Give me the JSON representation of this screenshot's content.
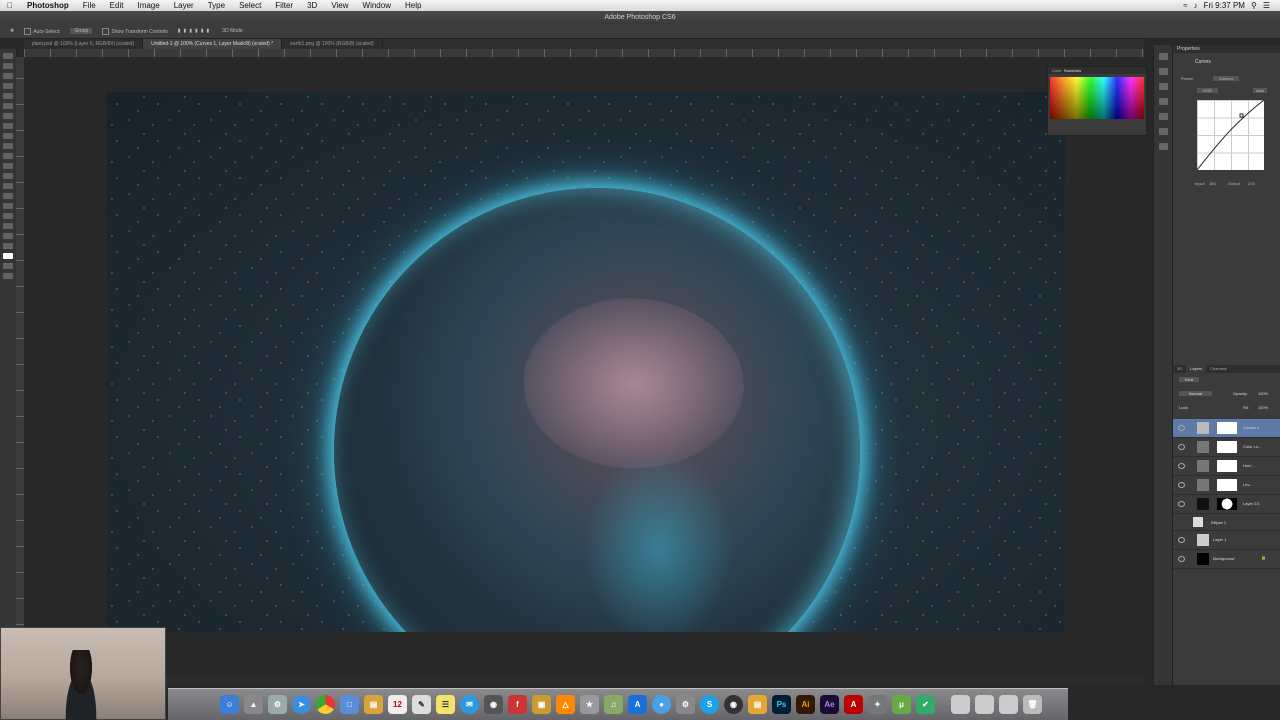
{
  "menubar": {
    "apple": "",
    "app_name": "Photoshop",
    "items": [
      "File",
      "Edit",
      "Image",
      "Layer",
      "Type",
      "Select",
      "Filter",
      "3D",
      "View",
      "Window",
      "Help"
    ],
    "clock": "Fri 9:37 PM"
  },
  "window": {
    "title": "Adobe Photoshop CS6"
  },
  "options_bar": {
    "auto_select_label": "Auto-Select:",
    "auto_select_value": "Group",
    "transform_label": "Show Transform Controls",
    "mode_3d": "3D Mode:"
  },
  "doc_tabs": [
    {
      "label": "plant.psd @ 100% (Layer 6, RGB/8#) (scaled)"
    },
    {
      "label": "Untitled-1 @ 100% (Curves 1, Layer Mask/8) (scaled) *"
    },
    {
      "label": "earth1.png @ 100% (RGB/8) (scaled)"
    }
  ],
  "swatches_panel": {
    "tab_color": "Color",
    "tab_swatches": "Swatches"
  },
  "properties_panel": {
    "title": "Properties",
    "adjustment": "Curves",
    "preset_label": "Preset:",
    "preset_value": "Custom",
    "channel_value": "RGB",
    "auto_label": "Auto",
    "input_label": "Input:",
    "input_value": "183",
    "output_label": "Output:",
    "output_value": "215"
  },
  "layers_panel": {
    "tabs": [
      "3D",
      "Layers",
      "Channels"
    ],
    "kind_label": "Kind",
    "blend_mode": "Normal",
    "opacity_label": "Opacity:",
    "opacity_value": "100%",
    "lock_label": "Lock:",
    "fill_label": "Fill:",
    "fill_value": "100%",
    "layers": [
      {
        "name": "Curves 1"
      },
      {
        "name": "Color Lo..."
      },
      {
        "name": "Hue/..."
      },
      {
        "name": "Lev..."
      },
      {
        "name": "Layer 2/1"
      },
      {
        "name": "Ellipse 1"
      },
      {
        "name": "Layer 1"
      },
      {
        "name": "Background"
      }
    ]
  },
  "dock": {
    "apps": [
      "Finder",
      "Launchpad",
      "Safari",
      "Chrome",
      "Preview",
      "Notes",
      "Calendar",
      "Mail",
      "Skype",
      "Photoshop",
      "Illustrator",
      "After Effects",
      "Acrobat",
      "Trash"
    ]
  },
  "colors": {
    "accent_selection": "#5e7aa6",
    "earth_glow": "#50d2f0"
  }
}
